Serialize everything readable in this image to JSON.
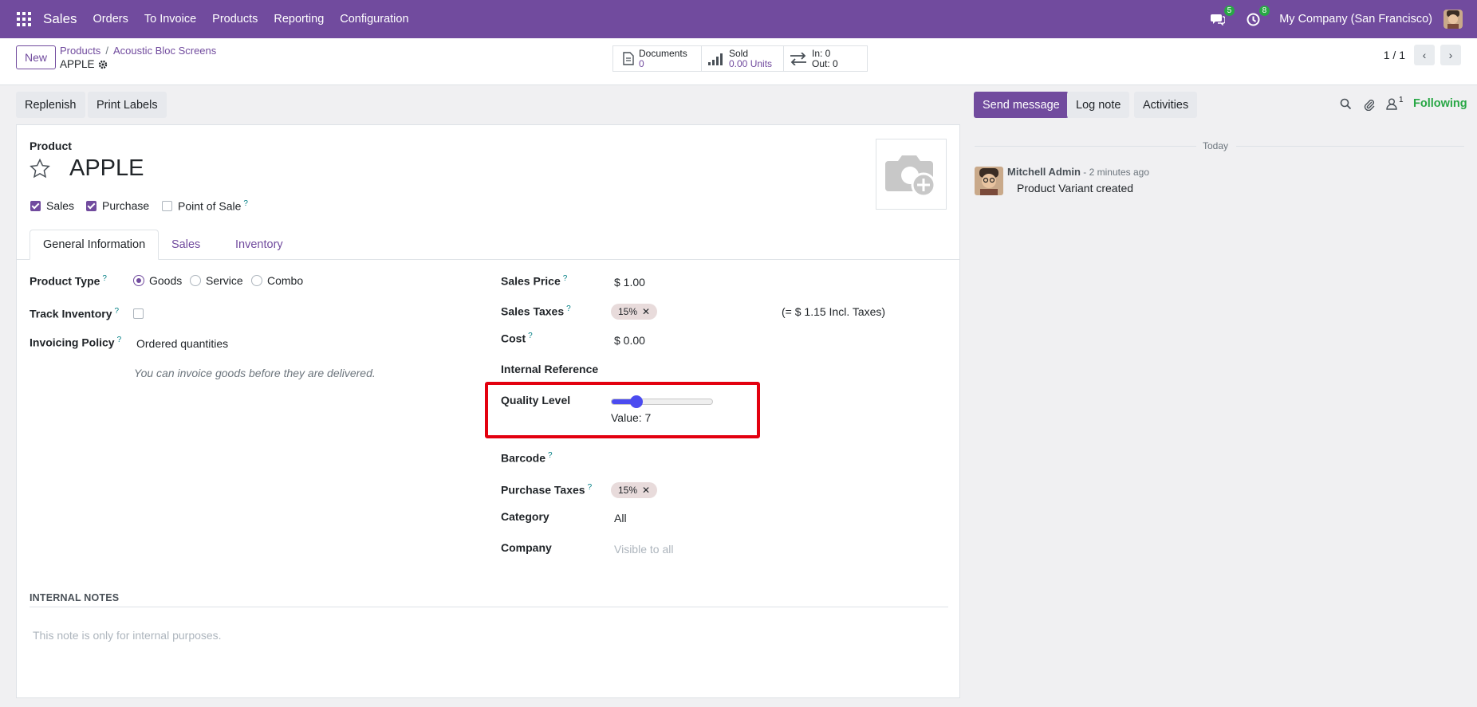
{
  "navbar": {
    "app_name": "Sales",
    "menu": [
      "Orders",
      "To Invoice",
      "Products",
      "Reporting",
      "Configuration"
    ],
    "messages_badge": "5",
    "activities_badge": "8",
    "company": "My Company (San Francisco)"
  },
  "control": {
    "new_label": "New",
    "breadcrumb": [
      "Products",
      "Acoustic Bloc Screens"
    ],
    "record_name": "APPLE",
    "stats": {
      "documents_label": "Documents",
      "documents_value": "0",
      "sold_label": "Sold",
      "sold_value": "0.00 Units",
      "in_label": "In: 0",
      "out_label": "Out: 0"
    },
    "pager": "1 / 1"
  },
  "actions": {
    "replenish": "Replenish",
    "print_labels": "Print Labels"
  },
  "chatter_actions": {
    "send_message": "Send message",
    "log_note": "Log note",
    "activities": "Activities",
    "followers_count": "1",
    "following": "Following"
  },
  "form": {
    "product_label": "Product",
    "name": "APPLE",
    "checkboxes": {
      "sales": "Sales",
      "purchase": "Purchase",
      "pos": "Point of Sale",
      "pos_help": "?"
    },
    "tabs": [
      "General Information",
      "Sales",
      "Inventory"
    ],
    "left": {
      "product_type_label": "Product Type",
      "product_type_options": [
        "Goods",
        "Service",
        "Combo"
      ],
      "track_inventory_label": "Track Inventory",
      "invoicing_policy_label": "Invoicing Policy",
      "invoicing_policy_value": "Ordered quantities",
      "invoicing_hint": "You can invoice goods before they are delivered."
    },
    "right": {
      "sales_price_label": "Sales Price",
      "sales_price_value": "$ 1.00",
      "sales_taxes_label": "Sales Taxes",
      "sales_taxes_tag": "15%",
      "incl_taxes": "(= $ 1.15 Incl. Taxes)",
      "cost_label": "Cost",
      "cost_value": "$ 0.00",
      "internal_ref_label": "Internal Reference",
      "quality_label": "Quality Level",
      "quality_value_text": "Value: 7",
      "quality_level": 0.25,
      "barcode_label": "Barcode",
      "purchase_taxes_label": "Purchase Taxes",
      "purchase_taxes_tag": "15%",
      "category_label": "Category",
      "category_value": "All",
      "company_label": "Company",
      "company_placeholder": "Visible to all"
    },
    "help": "?",
    "internal_notes_title": "INTERNAL NOTES",
    "internal_notes_placeholder": "This note is only for internal purposes."
  },
  "chatter": {
    "date_sep": "Today",
    "author": "Mitchell Admin",
    "time": " - 2 minutes ago",
    "body": "Product Variant created"
  },
  "colors": {
    "brand": "#714b9e",
    "slider": "#4b4bf0",
    "highlight": "#e3000f",
    "following": "#28a745"
  }
}
